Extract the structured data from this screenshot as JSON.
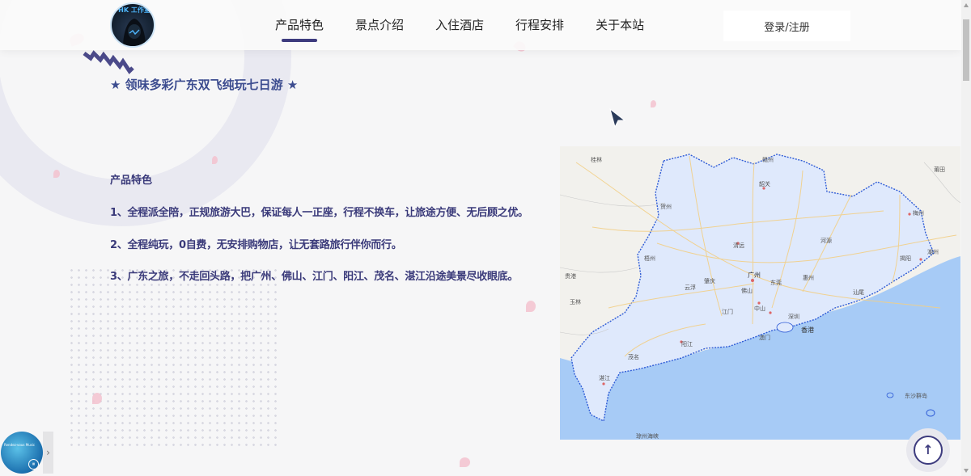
{
  "header": {
    "logo_text": "HK 工作室",
    "nav": [
      {
        "label": "产品特色",
        "active": true
      },
      {
        "label": "景点介绍",
        "active": false
      },
      {
        "label": "入住酒店",
        "active": false
      },
      {
        "label": "行程安排",
        "active": false
      },
      {
        "label": "关于本站",
        "active": false
      }
    ],
    "login_label": "登录/注册"
  },
  "main": {
    "title": "★ 领味多彩广东双飞纯玩七日游 ★",
    "section_title": "产品特色",
    "features": [
      "1、全程派全陪，正规旅游大巴，保证每人一正座，行程不换车，让旅途方便、无后顾之优。",
      "2、全程纯玩，0自费，无安排购物店，让无套路旅行伴你而行。",
      "3、广东之旅，不走回头路，把广州、佛山、江门、阳江、茂名、湛江沿途美景尽收眼底。"
    ]
  },
  "map": {
    "labels": {
      "guilin": "桂林",
      "ganzhou": "赣州",
      "shaoguan": "韶关",
      "hezhou": "贺州",
      "meizhou": "梅州",
      "heyuan": "河源",
      "qingyuan": "清远",
      "wuzhou": "梧州",
      "guangzhou": "广州",
      "dongguan": "东莞",
      "huizhou": "惠州",
      "shantou": "汕头",
      "zhaoqing": "肇庆",
      "yunfu": "云浮",
      "yulin": "玉林",
      "foshan": "佛山",
      "zhongshan": "中山",
      "jiangmen": "江门",
      "shenzhen": "深圳",
      "hongkong": "香港",
      "macau": "澳门",
      "yangjiang": "阳江",
      "maoming": "茂名",
      "zhanjiang": "湛江",
      "qiongzhou": "琼州海峡",
      "dongsha": "东沙群岛",
      "shanwei": "汕尾",
      "jieyang": "揭阳",
      "chaozhou": "潮州",
      "putian": "莆田",
      "guigang": "贵港"
    }
  },
  "player": {
    "caption": "Rendez-vous Music",
    "pause_icon": "⏸",
    "toggle_icon": "›"
  },
  "back_to_top": {
    "icon": "↑"
  },
  "colors": {
    "accent": "#3d3b7e",
    "title_blue": "#3c4c8f",
    "sea": "#a7cbf6",
    "province": "#dfe9fc",
    "border": "#2e5bd6"
  }
}
